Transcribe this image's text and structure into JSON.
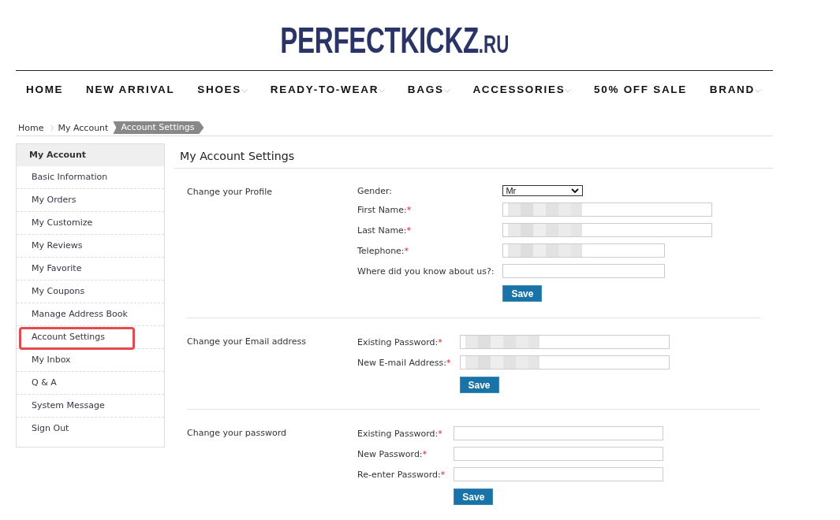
{
  "logo": {
    "name": "PERFECTKICKZ",
    "suffix": ".RU"
  },
  "nav": [
    {
      "label": "HOME",
      "has_dropdown": false
    },
    {
      "label": "NEW ARRIVAL",
      "has_dropdown": false
    },
    {
      "label": "SHOES",
      "has_dropdown": true
    },
    {
      "label": "READY-TO-WEAR",
      "has_dropdown": true
    },
    {
      "label": "BAGS",
      "has_dropdown": true
    },
    {
      "label": "ACCESSORIES",
      "has_dropdown": true
    },
    {
      "label": "50% OFF SALE",
      "has_dropdown": false
    },
    {
      "label": "BRAND",
      "has_dropdown": true
    }
  ],
  "breadcrumb": [
    {
      "label": "Home",
      "current": false
    },
    {
      "label": "My Account",
      "current": false
    },
    {
      "label": "Account Settings",
      "current": true
    }
  ],
  "sidebar": {
    "title": "My Account",
    "items": [
      {
        "label": "Basic Information",
        "highlighted": false
      },
      {
        "label": "My Orders",
        "highlighted": false
      },
      {
        "label": "My Customize",
        "highlighted": false
      },
      {
        "label": "My Reviews",
        "highlighted": false
      },
      {
        "label": "My Favorite",
        "highlighted": false
      },
      {
        "label": "My Coupons",
        "highlighted": false
      },
      {
        "label": "Manage Address Book",
        "highlighted": false
      },
      {
        "label": "Account Settings",
        "highlighted": true
      },
      {
        "label": "My Inbox",
        "highlighted": false
      },
      {
        "label": "Q & A",
        "highlighted": false
      },
      {
        "label": "System Message",
        "highlighted": false
      },
      {
        "label": "Sign Out",
        "highlighted": false
      }
    ]
  },
  "main": {
    "title": "My Account Settings",
    "sections": [
      {
        "heading": "Change your Profile",
        "fields": [
          {
            "kind": "select",
            "label": "Gender:",
            "value": "Mr"
          },
          {
            "kind": "text",
            "label": "First Name:",
            "required_mark": "*",
            "narrow": false,
            "redacted": true
          },
          {
            "kind": "text",
            "label": "Last Name:",
            "required_mark": "*",
            "narrow": false,
            "redacted": true
          },
          {
            "kind": "text",
            "label": "Telephone:",
            "required_mark": "*",
            "narrow": true,
            "redacted": true
          },
          {
            "kind": "text",
            "label": "Where did you know about us?:",
            "narrow": true,
            "redacted": false
          }
        ],
        "button": "Save"
      },
      {
        "heading": "Change your Email address",
        "fields": [
          {
            "kind": "text",
            "label": "Existing Password:",
            "required_mark": "*",
            "narrow": false,
            "redacted": true
          },
          {
            "kind": "text",
            "label": "New E-mail Address:",
            "required_mark": "*",
            "narrow": false,
            "redacted": true
          }
        ],
        "button": "Save"
      },
      {
        "heading": "Change your password",
        "fields": [
          {
            "kind": "text",
            "label": "Existing Password:",
            "required_mark": "*",
            "narrow": false,
            "redacted": false
          },
          {
            "kind": "text",
            "label": "New Password:",
            "required_mark": "*",
            "narrow": false,
            "redacted": false
          },
          {
            "kind": "text",
            "label": "Re-enter Password:",
            "required_mark": "*",
            "narrow": false,
            "redacted": false
          }
        ],
        "button": "Save"
      }
    ]
  }
}
